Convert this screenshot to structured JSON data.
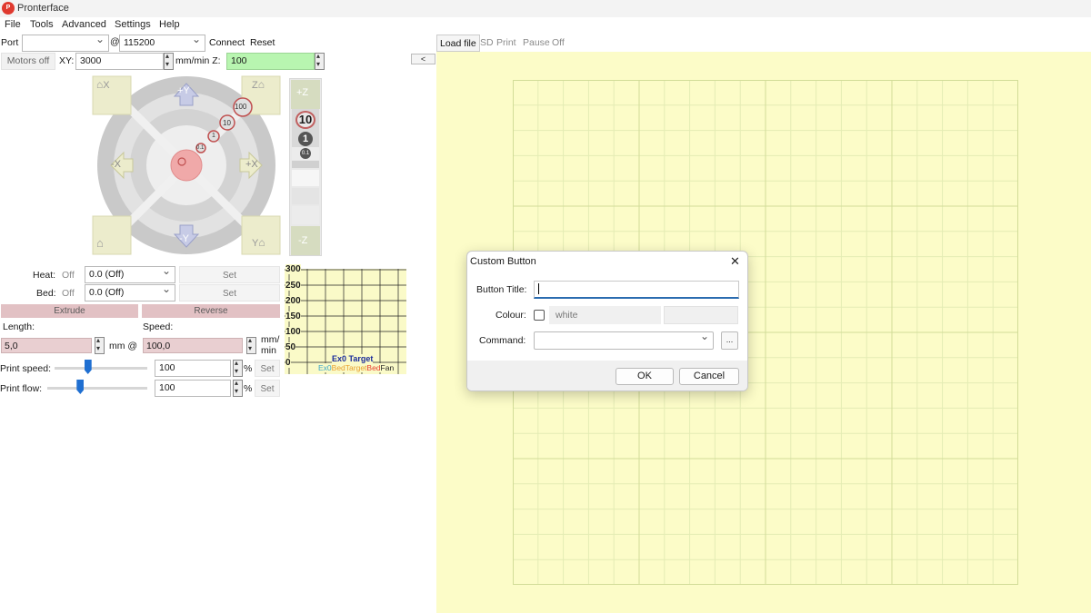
{
  "window": {
    "title": "Pronterface",
    "logo": "P"
  },
  "menu": [
    "File",
    "Tools",
    "Advanced",
    "Settings",
    "Help"
  ],
  "connection": {
    "port_label": "Port",
    "port_value": "",
    "at": "@",
    "baud_value": "115200",
    "connect": "Connect",
    "reset": "Reset"
  },
  "print_controls": {
    "load_file": "Load file",
    "sd": "SD",
    "print": "Print",
    "pause": "Pause",
    "off": "Off"
  },
  "collapse_button": "<",
  "motion": {
    "motors_off": "Motors off",
    "xy_label": "XY:",
    "xy_value": "3000",
    "feed_unit": "mm/min Z:",
    "z_value": "100"
  },
  "jog": {
    "home_x": "X",
    "home_z": "Z",
    "home_y": "Y",
    "plus_y": "+Y",
    "minus_y": "-Y",
    "plus_x": "+X",
    "minus_x": "-X",
    "steps": [
      "100",
      "10",
      "1",
      "0.1"
    ],
    "z_plus": "+Z",
    "z_minus": "-Z",
    "z_steps": [
      "10",
      "1",
      "0.1"
    ]
  },
  "temperature": {
    "heat_label": "Heat:",
    "heat_off": "Off",
    "heat_value": "0.0 (Off)",
    "bed_label": "Bed:",
    "bed_off": "Off",
    "bed_value": "0.0 (Off)",
    "set": "Set"
  },
  "extrusion": {
    "extrude": "Extrude",
    "reverse": "Reverse",
    "length_label": "Length:",
    "speed_label": "Speed:",
    "length_value": "5,0",
    "mm_at": "mm @",
    "speed_value": "100,0",
    "speed_unit_1": "mm/",
    "speed_unit_2": "min"
  },
  "factors": {
    "print_speed_label": "Print speed:",
    "print_speed_value": "100",
    "print_speed_slider": 0.36,
    "print_flow_label": "Print flow:",
    "print_flow_value": "100",
    "print_flow_slider": 0.33,
    "percent": "%",
    "set": "Set"
  },
  "temp_graph": {
    "y_ticks": [
      "300",
      "250",
      "200",
      "150",
      "100",
      "50",
      "0"
    ],
    "title": "Ex0 Target",
    "legend": [
      {
        "label": "Ex0",
        "color": "#3aa6c8"
      },
      {
        "label": "Bed",
        "color": "#e8a030"
      },
      {
        "label": "Target",
        "color": "#e8a030"
      },
      {
        "label": "Bed",
        "color": "#e84030"
      },
      {
        "label": "Fan",
        "color": "#222222"
      }
    ]
  },
  "dialog": {
    "title": "Custom Button",
    "close": "✕",
    "button_title_label": "Button Title:",
    "button_title_value": "",
    "colour_label": "Colour:",
    "colour_value": "white",
    "command_label": "Command:",
    "command_value": "",
    "browse": "...",
    "ok": "OK",
    "cancel": "Cancel"
  }
}
